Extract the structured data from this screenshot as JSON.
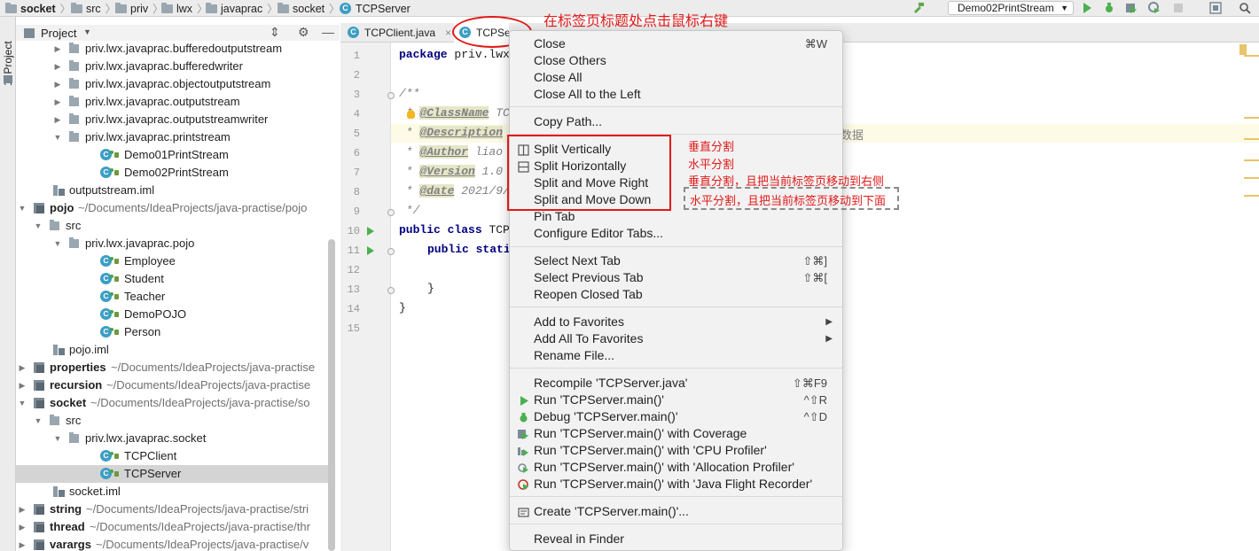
{
  "navbar": {
    "crumbs": [
      "socket",
      "src",
      "priv",
      "lwx",
      "javaprac",
      "socket",
      "TCPServer"
    ],
    "run_config": "Demo02PrintStream"
  },
  "stripe_label": "1: Project",
  "project_panel": {
    "title": "Project",
    "rows": [
      {
        "name": "priv.lwx.javaprac.bufferedoutputstream",
        "path": ""
      },
      {
        "name": "priv.lwx.javaprac.bufferedwriter",
        "path": ""
      },
      {
        "name": "priv.lwx.javaprac.objectoutputstream",
        "path": ""
      },
      {
        "name": "priv.lwx.javaprac.outputstream",
        "path": ""
      },
      {
        "name": "priv.lwx.javaprac.outputstreamwriter",
        "path": ""
      },
      {
        "name": "priv.lwx.javaprac.printstream",
        "path": ""
      },
      {
        "name": "Demo01PrintStream",
        "path": ""
      },
      {
        "name": "Demo02PrintStream",
        "path": ""
      },
      {
        "name": "outputstream.iml",
        "path": ""
      },
      {
        "name": "pojo",
        "path": "~/Documents/IdeaProjects/java-practise/pojo"
      },
      {
        "name": "src",
        "path": ""
      },
      {
        "name": "priv.lwx.javaprac.pojo",
        "path": ""
      },
      {
        "name": "Employee",
        "path": ""
      },
      {
        "name": "Student",
        "path": ""
      },
      {
        "name": "Teacher",
        "path": ""
      },
      {
        "name": "DemoPOJO",
        "path": ""
      },
      {
        "name": "Person",
        "path": ""
      },
      {
        "name": "pojo.iml",
        "path": ""
      },
      {
        "name": "properties",
        "path": "~/Documents/IdeaProjects/java-practise"
      },
      {
        "name": "recursion",
        "path": "~/Documents/IdeaProjects/java-practise"
      },
      {
        "name": "socket",
        "path": "~/Documents/IdeaProjects/java-practise/so"
      },
      {
        "name": "src",
        "path": ""
      },
      {
        "name": "priv.lwx.javaprac.socket",
        "path": ""
      },
      {
        "name": "TCPClient",
        "path": ""
      },
      {
        "name": "TCPServer",
        "path": ""
      },
      {
        "name": "socket.iml",
        "path": ""
      },
      {
        "name": "string",
        "path": "~/Documents/IdeaProjects/java-practise/stri"
      },
      {
        "name": "thread",
        "path": "~/Documents/IdeaProjects/java-practise/thr"
      },
      {
        "name": "varargs",
        "path": "~/Documents/IdeaProjects/java-practise/v"
      }
    ]
  },
  "tabs": [
    "TCPClient.java",
    "TCPSer"
  ],
  "editor": {
    "line_numbers": [
      "1",
      "2",
      "3",
      "4",
      "5",
      "6",
      "7",
      "8",
      "9",
      "10",
      "11",
      "12",
      "13",
      "14",
      "15"
    ],
    "line1": {
      "kw": "package",
      "rest": " priv.lwx"
    },
    "line3": "/**",
    "line4": {
      "prefix": " * ",
      "tag": "@ClassName",
      "rest": " TC"
    },
    "line5": {
      "prefix": " * ",
      "tag": "@Description"
    },
    "line5_tail": "数据",
    "line6": {
      "prefix": " * ",
      "tag": "@Author",
      "rest": " liao"
    },
    "line7": {
      "prefix": " * ",
      "tag": "@Version",
      "rest": " 1.0"
    },
    "line8": {
      "prefix": " * ",
      "tag": "@date",
      "rest": " 2021/9/"
    },
    "line9": " */",
    "line10": {
      "kw1": "public",
      "kw2": "class",
      "rest": " TCP"
    },
    "line11": {
      "kw1": "public",
      "kw2": "stati"
    },
    "line13": "}",
    "line14": "}"
  },
  "menu": {
    "close": {
      "label": "Close",
      "shortcut": "⌘W"
    },
    "close_others": "Close Others",
    "close_all": "Close All",
    "close_left": "Close All to the Left",
    "copy_path": "Copy Path...",
    "split_vertically": "Split Vertically",
    "split_horizontally": "Split Horizontally",
    "split_move_right": "Split and Move Right",
    "split_move_down": "Split and Move Down",
    "pin_tab": "Pin Tab",
    "configure_tabs": "Configure Editor Tabs...",
    "next_tab": {
      "label": "Select Next Tab",
      "shortcut": "⇧⌘]"
    },
    "prev_tab": {
      "label": "Select Previous Tab",
      "shortcut": "⇧⌘["
    },
    "reopen": "Reopen Closed Tab",
    "add_fav": "Add to Favorites",
    "add_all_fav": "Add All To Favorites",
    "rename": "Rename File...",
    "recompile": {
      "label": "Recompile 'TCPServer.java'",
      "shortcut": "⇧⌘F9"
    },
    "run": {
      "label": "Run 'TCPServer.main()'",
      "shortcut": "^⇧R"
    },
    "debug": {
      "label": "Debug 'TCPServer.main()'",
      "shortcut": "^⇧D"
    },
    "run_coverage": "Run 'TCPServer.main()' with Coverage",
    "run_cpu": "Run 'TCPServer.main()' with 'CPU Profiler'",
    "run_alloc": "Run 'TCPServer.main()' with 'Allocation Profiler'",
    "run_jfr": "Run 'TCPServer.main()' with 'Java Flight Recorder'",
    "create": "Create 'TCPServer.main()'...",
    "reveal": "Reveal in Finder"
  },
  "annotations": {
    "title": "在标签页标题处点击鼠标右键",
    "split_v": "垂直分割",
    "split_h": "水平分割",
    "split_right": "垂直分割，且把当前标签页移动到右侧",
    "split_down": "水平分割，且把当前标签页移动到下面"
  },
  "colors": {
    "annotation": "#e11a1a",
    "accent": "#3d9ec4",
    "run": "#4caf50"
  }
}
